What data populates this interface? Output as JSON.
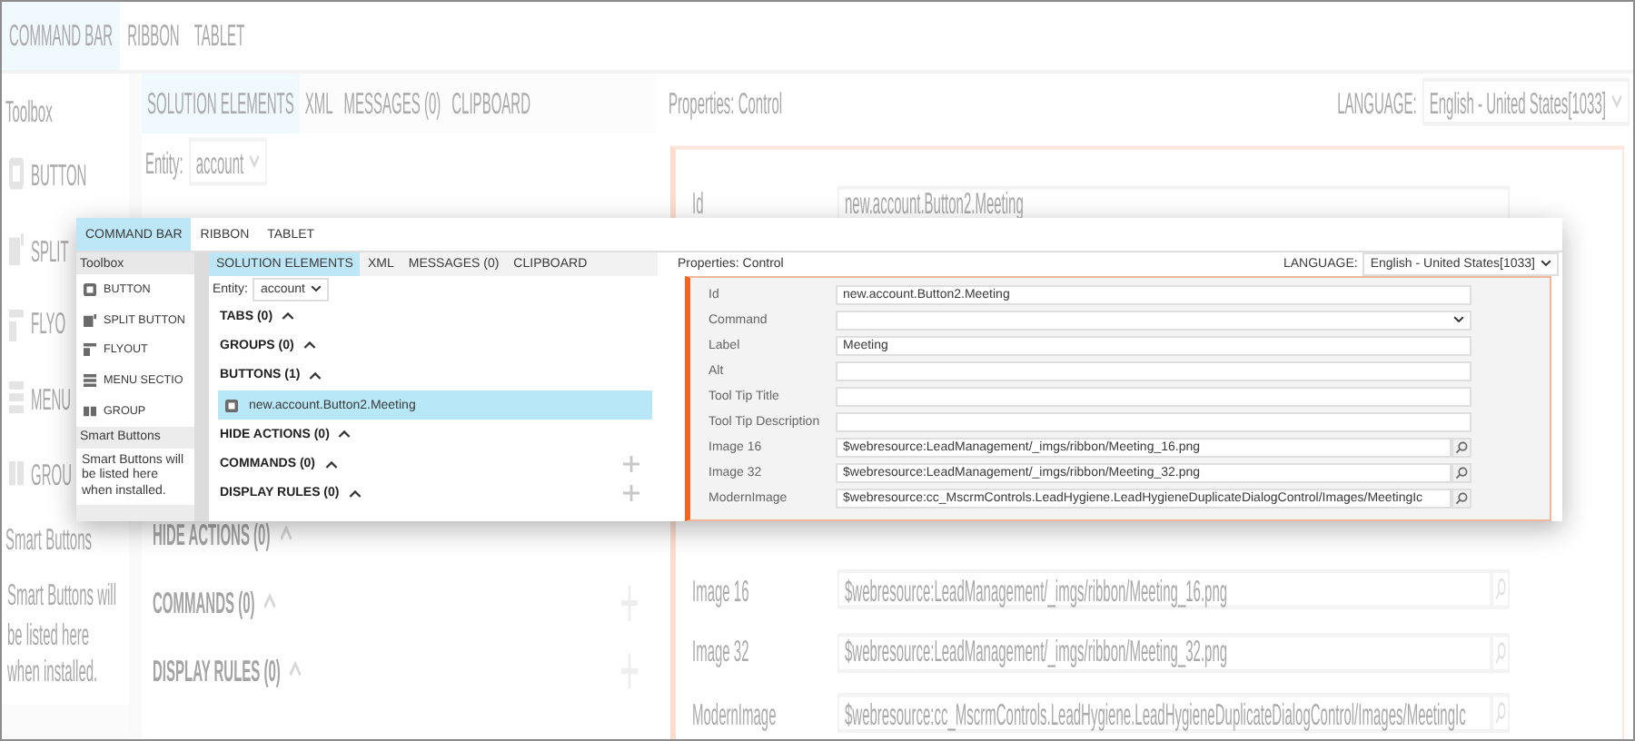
{
  "backdrop": {
    "tabs": [
      {
        "label": "COMMAND BAR",
        "selected": true
      },
      {
        "label": "RIBBON",
        "selected": false
      },
      {
        "label": "TABLET",
        "selected": false
      }
    ],
    "toolbox": {
      "title": "Toolbox",
      "items": [
        {
          "label": "BUTTON",
          "kind": "button"
        },
        {
          "label": "SPLIT",
          "kind": "split_button"
        },
        {
          "label": "FLYO",
          "kind": "flyout"
        },
        {
          "label": "MENU",
          "kind": "menu_section"
        },
        {
          "label": "GROU",
          "kind": "group"
        }
      ]
    },
    "smart_buttons": {
      "title": "Smart Buttons",
      "text": "Smart Buttons will be listed here when installed."
    },
    "solution_tabs": [
      {
        "label": "SOLUTION ELEMENTS",
        "selected": true
      },
      {
        "label": "XML",
        "selected": false
      },
      {
        "label": "MESSAGES (0)",
        "selected": false
      },
      {
        "label": "CLIPBOARD",
        "selected": false
      }
    ],
    "entity": {
      "label": "Entity:",
      "value": "account"
    },
    "sections": [
      {
        "title": "HIDE ACTIONS (0)",
        "expanded": true,
        "addable": false
      },
      {
        "title": "COMMANDS (0)",
        "expanded": true,
        "addable": true
      },
      {
        "title": "DISPLAY RULES (0)",
        "expanded": true,
        "addable": true
      }
    ],
    "properties": {
      "title": "Properties: Control",
      "language_label": "LANGUAGE:",
      "language": "English - United States[1033]",
      "fields": [
        {
          "label": "Id",
          "value": "new.account.Button2.Meeting",
          "kind": "text"
        }
      ],
      "more_fields": [
        {
          "label": "Image 16",
          "value": "$webresource:LeadManagement/_imgs/ribbon/Meeting_16.png",
          "kind": "lookup"
        },
        {
          "label": "Image 32",
          "value": "$webresource:LeadManagement/_imgs/ribbon/Meeting_32.png",
          "kind": "lookup"
        },
        {
          "label": "ModernImage",
          "value": "$webresource:cc_MscrmControls.LeadHygiene.LeadHygieneDuplicateDialogControl/Images/MeetingIc",
          "kind": "lookup"
        }
      ]
    }
  },
  "dialog": {
    "tabs": [
      {
        "label": "COMMAND BAR",
        "selected": true
      },
      {
        "label": "RIBBON",
        "selected": false
      },
      {
        "label": "TABLET",
        "selected": false
      }
    ],
    "toolbox": {
      "title": "Toolbox",
      "items": [
        {
          "label": "BUTTON",
          "kind": "button"
        },
        {
          "label": "SPLIT BUTTON",
          "kind": "split_button"
        },
        {
          "label": "FLYOUT",
          "kind": "flyout"
        },
        {
          "label": "MENU SECTIO",
          "kind": "menu_section"
        },
        {
          "label": "GROUP",
          "kind": "group"
        }
      ]
    },
    "smart_buttons": {
      "title": "Smart Buttons",
      "text": "Smart Buttons will be listed here when installed."
    },
    "solution_tabs": [
      {
        "label": "SOLUTION ELEMENTS",
        "selected": true
      },
      {
        "label": "XML",
        "selected": false
      },
      {
        "label": "MESSAGES (0)",
        "selected": false
      },
      {
        "label": "CLIPBOARD",
        "selected": false
      }
    ],
    "entity": {
      "label": "Entity:",
      "value": "account"
    },
    "sections": [
      {
        "title": "TABS (0)",
        "expanded": true,
        "addable": false
      },
      {
        "title": "GROUPS (0)",
        "expanded": true,
        "addable": false
      },
      {
        "title": "BUTTONS (1)",
        "expanded": true,
        "addable": false,
        "children": [
          {
            "label": "new.account.Button2.Meeting",
            "selected": true
          }
        ]
      },
      {
        "title": "HIDE ACTIONS (0)",
        "expanded": true,
        "addable": false
      },
      {
        "title": "COMMANDS (0)",
        "expanded": true,
        "addable": true
      },
      {
        "title": "DISPLAY RULES (0)",
        "expanded": true,
        "addable": true
      }
    ],
    "properties": {
      "title": "Properties: Control",
      "language_label": "LANGUAGE:",
      "language": "English - United States[1033]",
      "fields": [
        {
          "label": "Id",
          "value": "new.account.Button2.Meeting",
          "kind": "text"
        },
        {
          "label": "Command",
          "kind": "select"
        },
        {
          "label": "Label",
          "value": "Meeting",
          "kind": "text"
        },
        {
          "label": "Alt",
          "kind": "text"
        },
        {
          "label": "Tool Tip Title",
          "kind": "text"
        },
        {
          "label": "Tool Tip Description",
          "kind": "text"
        },
        {
          "label": "Image 16",
          "value": "$webresource:LeadManagement/_imgs/ribbon/Meeting_16.png",
          "kind": "lookup"
        },
        {
          "label": "Image 32",
          "value": "$webresource:LeadManagement/_imgs/ribbon/Meeting_32.png",
          "kind": "lookup"
        },
        {
          "label": "ModernImage",
          "value": "$webresource:cc_MscrmControls.LeadHygiene.LeadHygieneDuplicateDialogControl/Images/MeetingIc",
          "kind": "lookup"
        }
      ]
    }
  }
}
